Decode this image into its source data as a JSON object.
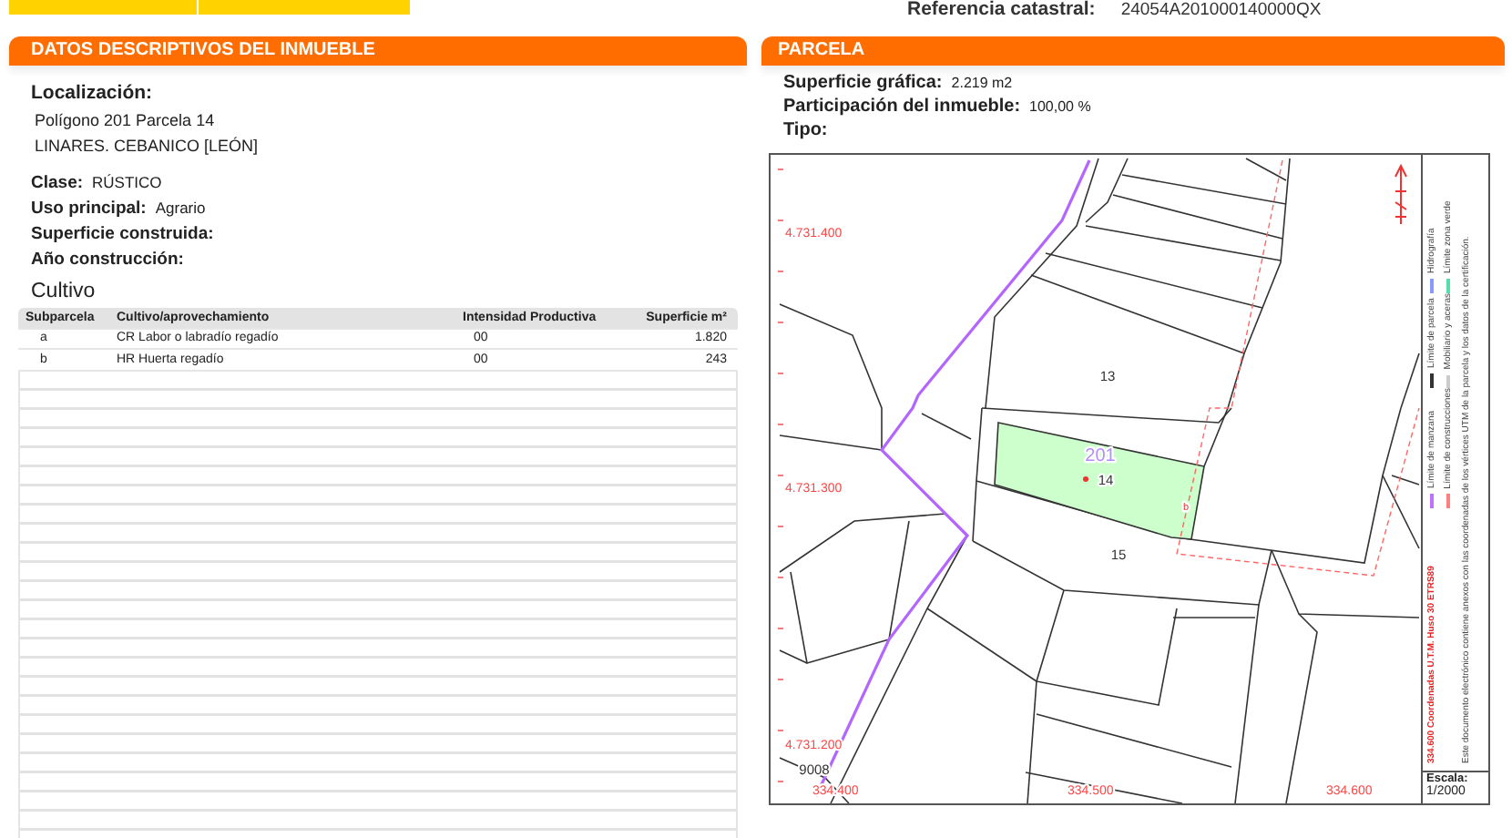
{
  "header": {
    "reference_label": "Referencia catastral:",
    "reference_value": "24054A201000140000QX"
  },
  "descriptive": {
    "title": "DATOS DESCRIPTIVOS DEL INMUEBLE",
    "location_label": "Localización:",
    "location_lines": [
      "Polígono 201 Parcela 14",
      "LINARES. CEBANICO [LEÓN]"
    ],
    "fields": [
      {
        "label": "Clase:",
        "value": "RÚSTICO"
      },
      {
        "label": "Uso principal:",
        "value": "Agrario"
      },
      {
        "label": "Superficie construida:"
      },
      {
        "label": "Año construcción:"
      }
    ],
    "cultivo": {
      "title": "Cultivo",
      "columns": [
        "Subparcela",
        "Cultivo/aprovechamiento",
        "Intensidad Productiva",
        "Superficie m²"
      ],
      "rows": [
        [
          "a",
          "CR Labor o labradío regadío",
          "00",
          "1.820"
        ],
        [
          "b",
          "HR Huerta regadío",
          "00",
          "243"
        ]
      ]
    }
  },
  "parcela": {
    "title": "PARCELA",
    "fields": [
      {
        "label": "Superficie gráfica:",
        "value": "2.219 m2"
      },
      {
        "label": "Participación del inmueble:",
        "value": "100,00 %"
      },
      {
        "label": "Tipo:"
      }
    ],
    "map": {
      "labels": [
        {
          "kind": "parcel",
          "text": "13"
        },
        {
          "kind": "polygon",
          "text": "201"
        },
        {
          "kind": "parcel",
          "text": "14"
        },
        {
          "kind": "parcel",
          "text": "15"
        },
        {
          "kind": "subparcel",
          "text": "b"
        },
        {
          "kind": "parcel",
          "text": "9008"
        }
      ],
      "northings": [
        "4.731.400",
        "4.731.300",
        "4.731.200"
      ],
      "eastings": [
        "334.400",
        "334.500",
        "334.600"
      ],
      "legend": {
        "coordinate_system": "334.600 Coordenadas U.T.M. Huso 30 ETRS89",
        "items": [
          {
            "label": "Límite de manzana",
            "color": "#c070ff"
          },
          {
            "label": "Límite de parcela",
            "color": "#333333"
          },
          {
            "label": "Hidrografía",
            "color": "#8899ff"
          },
          {
            "label": "Límite de construcciones",
            "color": "#ff8080"
          },
          {
            "label": "Mobiliario y aceras",
            "color": "#cccccc"
          },
          {
            "label": "Límite zona verde",
            "color": "#55ddaa"
          }
        ],
        "note": "Este documento electrónico contiene anexos con las coordenadas de los vértices UTM de la parcela y los datos de la certificación."
      },
      "scale_label": "Escala:",
      "scale_value": "1/2000"
    }
  }
}
